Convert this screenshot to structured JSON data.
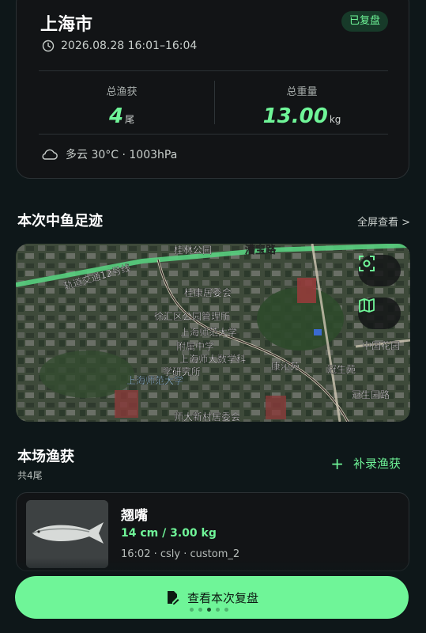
{
  "summary": {
    "city": "上海市",
    "status_badge": "已复盘",
    "time_range": "2026.08.28 16:01–16:04",
    "total_catch_label": "总渔获",
    "total_catch_value": "4",
    "total_catch_unit": "尾",
    "total_weight_label": "总重量",
    "total_weight_value": "13.00",
    "total_weight_unit": "kg",
    "weather": "多云 30°C · 1003hPa"
  },
  "footprint": {
    "title": "本次中鱼足迹",
    "fullscreen_link": "全屏查看 >",
    "map_labels": [
      {
        "text": "桂林公园",
        "kind": "poi"
      },
      {
        "text": "漕宝路",
        "kind": "road"
      },
      {
        "text": "轨道交通12号线",
        "kind": "metro"
      },
      {
        "text": "桂康居委会",
        "kind": "poi"
      },
      {
        "text": "徐汇区公园管理所",
        "kind": "poi"
      },
      {
        "text": "上海师范大学",
        "kind": "poi"
      },
      {
        "text": "附属中学",
        "kind": "poi"
      },
      {
        "text": "上海师大数学科",
        "kind": "poi"
      },
      {
        "text": "学研究所",
        "kind": "poi"
      },
      {
        "text": "上海师范大学",
        "kind": "poi2"
      },
      {
        "text": "康沁苑",
        "kind": "poi"
      },
      {
        "text": "冠生苑",
        "kind": "poi"
      },
      {
        "text": "中国花园",
        "kind": "poi"
      },
      {
        "text": "冠生园路",
        "kind": "poi"
      },
      {
        "text": "师大新村居委会",
        "kind": "poi"
      }
    ],
    "map_buttons": [
      "locate-icon",
      "map-layers-icon"
    ]
  },
  "catches": {
    "title": "本场渔获",
    "count_text": "共4尾",
    "add_label": "补录渔获",
    "items": [
      {
        "name": "翘嘴",
        "size": "14 cm / 3.00 kg",
        "meta": "16:02 · csly · custom_2"
      }
    ]
  },
  "review_button": {
    "label": "查看本次复盘",
    "page_dots": 5,
    "active_dot": 2
  },
  "colors": {
    "accent": "#6ff598",
    "background": "#0e1719",
    "card": "#121416"
  }
}
